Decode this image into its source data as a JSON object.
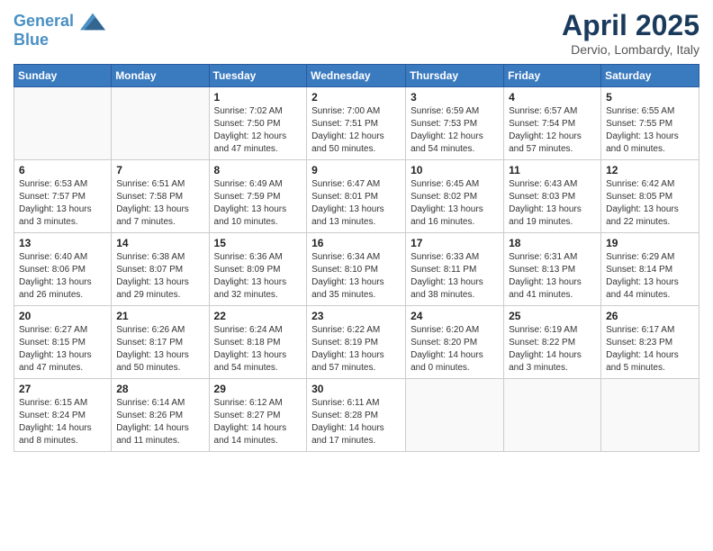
{
  "header": {
    "logo_line1": "General",
    "logo_line2": "Blue",
    "month_title": "April 2025",
    "subtitle": "Dervio, Lombardy, Italy"
  },
  "days_of_week": [
    "Sunday",
    "Monday",
    "Tuesday",
    "Wednesday",
    "Thursday",
    "Friday",
    "Saturday"
  ],
  "weeks": [
    [
      {
        "num": "",
        "info": ""
      },
      {
        "num": "",
        "info": ""
      },
      {
        "num": "1",
        "info": "Sunrise: 7:02 AM\nSunset: 7:50 PM\nDaylight: 12 hours and 47 minutes."
      },
      {
        "num": "2",
        "info": "Sunrise: 7:00 AM\nSunset: 7:51 PM\nDaylight: 12 hours and 50 minutes."
      },
      {
        "num": "3",
        "info": "Sunrise: 6:59 AM\nSunset: 7:53 PM\nDaylight: 12 hours and 54 minutes."
      },
      {
        "num": "4",
        "info": "Sunrise: 6:57 AM\nSunset: 7:54 PM\nDaylight: 12 hours and 57 minutes."
      },
      {
        "num": "5",
        "info": "Sunrise: 6:55 AM\nSunset: 7:55 PM\nDaylight: 13 hours and 0 minutes."
      }
    ],
    [
      {
        "num": "6",
        "info": "Sunrise: 6:53 AM\nSunset: 7:57 PM\nDaylight: 13 hours and 3 minutes."
      },
      {
        "num": "7",
        "info": "Sunrise: 6:51 AM\nSunset: 7:58 PM\nDaylight: 13 hours and 7 minutes."
      },
      {
        "num": "8",
        "info": "Sunrise: 6:49 AM\nSunset: 7:59 PM\nDaylight: 13 hours and 10 minutes."
      },
      {
        "num": "9",
        "info": "Sunrise: 6:47 AM\nSunset: 8:01 PM\nDaylight: 13 hours and 13 minutes."
      },
      {
        "num": "10",
        "info": "Sunrise: 6:45 AM\nSunset: 8:02 PM\nDaylight: 13 hours and 16 minutes."
      },
      {
        "num": "11",
        "info": "Sunrise: 6:43 AM\nSunset: 8:03 PM\nDaylight: 13 hours and 19 minutes."
      },
      {
        "num": "12",
        "info": "Sunrise: 6:42 AM\nSunset: 8:05 PM\nDaylight: 13 hours and 22 minutes."
      }
    ],
    [
      {
        "num": "13",
        "info": "Sunrise: 6:40 AM\nSunset: 8:06 PM\nDaylight: 13 hours and 26 minutes."
      },
      {
        "num": "14",
        "info": "Sunrise: 6:38 AM\nSunset: 8:07 PM\nDaylight: 13 hours and 29 minutes."
      },
      {
        "num": "15",
        "info": "Sunrise: 6:36 AM\nSunset: 8:09 PM\nDaylight: 13 hours and 32 minutes."
      },
      {
        "num": "16",
        "info": "Sunrise: 6:34 AM\nSunset: 8:10 PM\nDaylight: 13 hours and 35 minutes."
      },
      {
        "num": "17",
        "info": "Sunrise: 6:33 AM\nSunset: 8:11 PM\nDaylight: 13 hours and 38 minutes."
      },
      {
        "num": "18",
        "info": "Sunrise: 6:31 AM\nSunset: 8:13 PM\nDaylight: 13 hours and 41 minutes."
      },
      {
        "num": "19",
        "info": "Sunrise: 6:29 AM\nSunset: 8:14 PM\nDaylight: 13 hours and 44 minutes."
      }
    ],
    [
      {
        "num": "20",
        "info": "Sunrise: 6:27 AM\nSunset: 8:15 PM\nDaylight: 13 hours and 47 minutes."
      },
      {
        "num": "21",
        "info": "Sunrise: 6:26 AM\nSunset: 8:17 PM\nDaylight: 13 hours and 50 minutes."
      },
      {
        "num": "22",
        "info": "Sunrise: 6:24 AM\nSunset: 8:18 PM\nDaylight: 13 hours and 54 minutes."
      },
      {
        "num": "23",
        "info": "Sunrise: 6:22 AM\nSunset: 8:19 PM\nDaylight: 13 hours and 57 minutes."
      },
      {
        "num": "24",
        "info": "Sunrise: 6:20 AM\nSunset: 8:20 PM\nDaylight: 14 hours and 0 minutes."
      },
      {
        "num": "25",
        "info": "Sunrise: 6:19 AM\nSunset: 8:22 PM\nDaylight: 14 hours and 3 minutes."
      },
      {
        "num": "26",
        "info": "Sunrise: 6:17 AM\nSunset: 8:23 PM\nDaylight: 14 hours and 5 minutes."
      }
    ],
    [
      {
        "num": "27",
        "info": "Sunrise: 6:15 AM\nSunset: 8:24 PM\nDaylight: 14 hours and 8 minutes."
      },
      {
        "num": "28",
        "info": "Sunrise: 6:14 AM\nSunset: 8:26 PM\nDaylight: 14 hours and 11 minutes."
      },
      {
        "num": "29",
        "info": "Sunrise: 6:12 AM\nSunset: 8:27 PM\nDaylight: 14 hours and 14 minutes."
      },
      {
        "num": "30",
        "info": "Sunrise: 6:11 AM\nSunset: 8:28 PM\nDaylight: 14 hours and 17 minutes."
      },
      {
        "num": "",
        "info": ""
      },
      {
        "num": "",
        "info": ""
      },
      {
        "num": "",
        "info": ""
      }
    ]
  ]
}
